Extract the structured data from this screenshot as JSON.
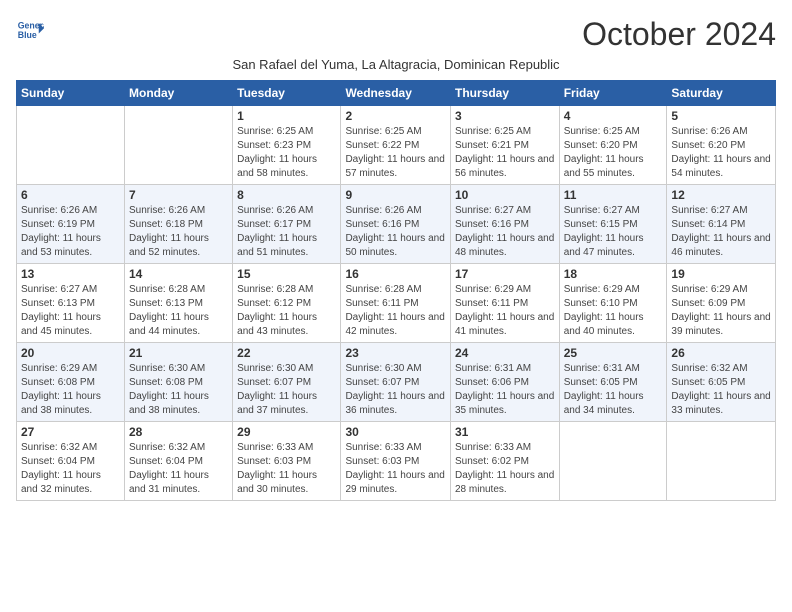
{
  "header": {
    "logo_line1": "General",
    "logo_line2": "Blue",
    "month_title": "October 2024",
    "subtitle": "San Rafael del Yuma, La Altagracia, Dominican Republic"
  },
  "weekdays": [
    "Sunday",
    "Monday",
    "Tuesday",
    "Wednesday",
    "Thursday",
    "Friday",
    "Saturday"
  ],
  "weeks": [
    [
      {
        "day": "",
        "info": ""
      },
      {
        "day": "",
        "info": ""
      },
      {
        "day": "1",
        "info": "Sunrise: 6:25 AM\nSunset: 6:23 PM\nDaylight: 11 hours and 58 minutes."
      },
      {
        "day": "2",
        "info": "Sunrise: 6:25 AM\nSunset: 6:22 PM\nDaylight: 11 hours and 57 minutes."
      },
      {
        "day": "3",
        "info": "Sunrise: 6:25 AM\nSunset: 6:21 PM\nDaylight: 11 hours and 56 minutes."
      },
      {
        "day": "4",
        "info": "Sunrise: 6:25 AM\nSunset: 6:20 PM\nDaylight: 11 hours and 55 minutes."
      },
      {
        "day": "5",
        "info": "Sunrise: 6:26 AM\nSunset: 6:20 PM\nDaylight: 11 hours and 54 minutes."
      }
    ],
    [
      {
        "day": "6",
        "info": "Sunrise: 6:26 AM\nSunset: 6:19 PM\nDaylight: 11 hours and 53 minutes."
      },
      {
        "day": "7",
        "info": "Sunrise: 6:26 AM\nSunset: 6:18 PM\nDaylight: 11 hours and 52 minutes."
      },
      {
        "day": "8",
        "info": "Sunrise: 6:26 AM\nSunset: 6:17 PM\nDaylight: 11 hours and 51 minutes."
      },
      {
        "day": "9",
        "info": "Sunrise: 6:26 AM\nSunset: 6:16 PM\nDaylight: 11 hours and 50 minutes."
      },
      {
        "day": "10",
        "info": "Sunrise: 6:27 AM\nSunset: 6:16 PM\nDaylight: 11 hours and 48 minutes."
      },
      {
        "day": "11",
        "info": "Sunrise: 6:27 AM\nSunset: 6:15 PM\nDaylight: 11 hours and 47 minutes."
      },
      {
        "day": "12",
        "info": "Sunrise: 6:27 AM\nSunset: 6:14 PM\nDaylight: 11 hours and 46 minutes."
      }
    ],
    [
      {
        "day": "13",
        "info": "Sunrise: 6:27 AM\nSunset: 6:13 PM\nDaylight: 11 hours and 45 minutes."
      },
      {
        "day": "14",
        "info": "Sunrise: 6:28 AM\nSunset: 6:13 PM\nDaylight: 11 hours and 44 minutes."
      },
      {
        "day": "15",
        "info": "Sunrise: 6:28 AM\nSunset: 6:12 PM\nDaylight: 11 hours and 43 minutes."
      },
      {
        "day": "16",
        "info": "Sunrise: 6:28 AM\nSunset: 6:11 PM\nDaylight: 11 hours and 42 minutes."
      },
      {
        "day": "17",
        "info": "Sunrise: 6:29 AM\nSunset: 6:11 PM\nDaylight: 11 hours and 41 minutes."
      },
      {
        "day": "18",
        "info": "Sunrise: 6:29 AM\nSunset: 6:10 PM\nDaylight: 11 hours and 40 minutes."
      },
      {
        "day": "19",
        "info": "Sunrise: 6:29 AM\nSunset: 6:09 PM\nDaylight: 11 hours and 39 minutes."
      }
    ],
    [
      {
        "day": "20",
        "info": "Sunrise: 6:29 AM\nSunset: 6:08 PM\nDaylight: 11 hours and 38 minutes."
      },
      {
        "day": "21",
        "info": "Sunrise: 6:30 AM\nSunset: 6:08 PM\nDaylight: 11 hours and 38 minutes."
      },
      {
        "day": "22",
        "info": "Sunrise: 6:30 AM\nSunset: 6:07 PM\nDaylight: 11 hours and 37 minutes."
      },
      {
        "day": "23",
        "info": "Sunrise: 6:30 AM\nSunset: 6:07 PM\nDaylight: 11 hours and 36 minutes."
      },
      {
        "day": "24",
        "info": "Sunrise: 6:31 AM\nSunset: 6:06 PM\nDaylight: 11 hours and 35 minutes."
      },
      {
        "day": "25",
        "info": "Sunrise: 6:31 AM\nSunset: 6:05 PM\nDaylight: 11 hours and 34 minutes."
      },
      {
        "day": "26",
        "info": "Sunrise: 6:32 AM\nSunset: 6:05 PM\nDaylight: 11 hours and 33 minutes."
      }
    ],
    [
      {
        "day": "27",
        "info": "Sunrise: 6:32 AM\nSunset: 6:04 PM\nDaylight: 11 hours and 32 minutes."
      },
      {
        "day": "28",
        "info": "Sunrise: 6:32 AM\nSunset: 6:04 PM\nDaylight: 11 hours and 31 minutes."
      },
      {
        "day": "29",
        "info": "Sunrise: 6:33 AM\nSunset: 6:03 PM\nDaylight: 11 hours and 30 minutes."
      },
      {
        "day": "30",
        "info": "Sunrise: 6:33 AM\nSunset: 6:03 PM\nDaylight: 11 hours and 29 minutes."
      },
      {
        "day": "31",
        "info": "Sunrise: 6:33 AM\nSunset: 6:02 PM\nDaylight: 11 hours and 28 minutes."
      },
      {
        "day": "",
        "info": ""
      },
      {
        "day": "",
        "info": ""
      }
    ]
  ]
}
